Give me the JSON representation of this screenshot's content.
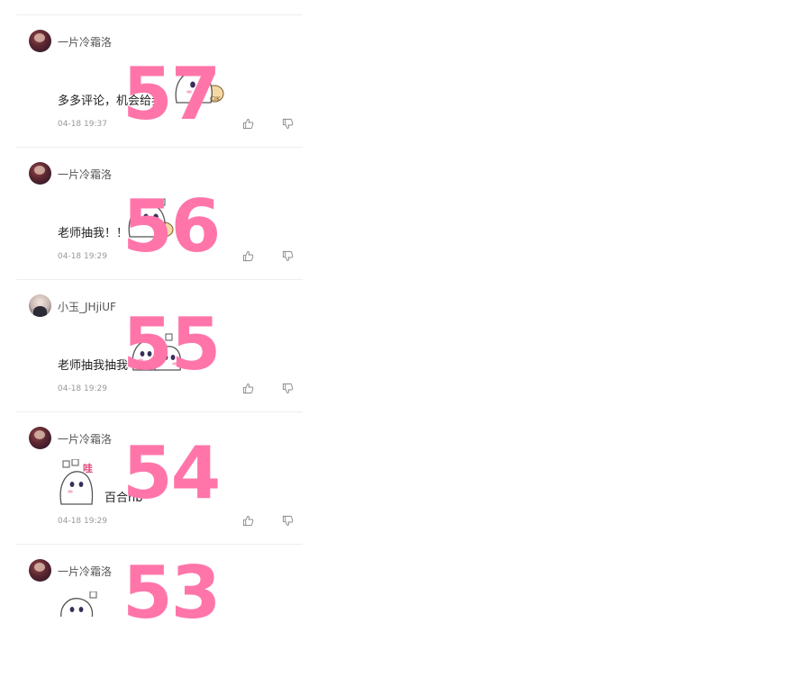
{
  "comments": [
    {
      "index_label": "57",
      "username": "一片冷霜洛",
      "content": "多多评论，机会给我！",
      "time": "04-18 19:37",
      "avatar": "dark",
      "sticker": "ghost-with-bun"
    },
    {
      "index_label": "56",
      "username": "一片冷霜洛",
      "content": "老师抽我！！",
      "time": "04-18 19:29",
      "avatar": "dark",
      "sticker": "ghost-with-bun"
    },
    {
      "index_label": "55",
      "username": "小玉_JHjiUF",
      "content": "老师抽我抽我",
      "time": "04-18 19:29",
      "avatar": "light",
      "sticker": "ghost-blush"
    },
    {
      "index_label": "54",
      "username": "一片冷霜洛",
      "content": "百合hb",
      "time": "04-18 19:29",
      "avatar": "dark",
      "sticker": "ghost-hug"
    },
    {
      "index_label": "53",
      "username": "一片冷霜洛",
      "content": "",
      "time": "",
      "avatar": "dark",
      "sticker": "ghost-peek"
    }
  ],
  "icons": {
    "like": "thumbs-up-icon",
    "dislike": "thumbs-down-icon"
  },
  "colors": {
    "overlay_number": "#ff75aa",
    "divider": "#eeeeee",
    "meta_text": "#999999"
  }
}
